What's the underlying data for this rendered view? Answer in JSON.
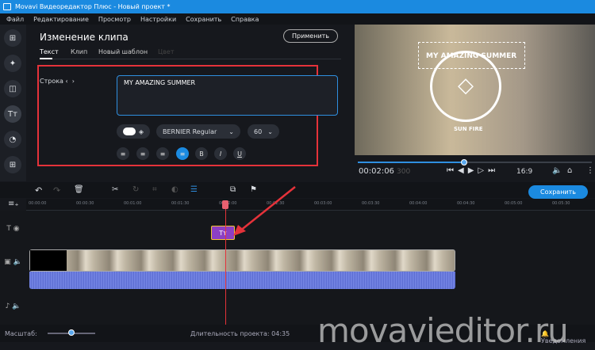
{
  "window": {
    "title": "Movavi Видеоредактор Плюс - Новый проект *"
  },
  "menu": [
    "Файл",
    "Редактирование",
    "Просмотр",
    "Настройки",
    "Сохранить",
    "Справка"
  ],
  "panel": {
    "title": "Изменение клипа",
    "apply": "Применить",
    "tabs": [
      "Текст",
      "Клип",
      "Новый шаблон",
      "Цвет"
    ],
    "row_label": "Строка",
    "text_value": "MY AMAZING SUMMER",
    "font": "BERNIER Regular",
    "size": "60",
    "format_buttons": [
      "align-left",
      "align-center",
      "align-right",
      "align-justify",
      "B",
      "I",
      "U"
    ]
  },
  "preview": {
    "overlay_title": "MY AMAZING SUMMER",
    "overlay_sub": "SUN FIRE",
    "time": "00:02:06",
    "ms": "300",
    "aspect": "16:9"
  },
  "timeline": {
    "save": "Сохранить",
    "ruler": [
      "00:00:00",
      "00:00:30",
      "00:01:00",
      "00:01:30",
      "00:02:00",
      "00:02:30",
      "00:03:00",
      "00:03:30",
      "00:04:00",
      "00:04:30",
      "00:05:00",
      "00:05:30"
    ],
    "title_clip": "Tт",
    "playhead_progress": 0.44
  },
  "status": {
    "scale_label": "Масштаб:",
    "duration": "Длительность проекта: 04:35",
    "notifications": "Уведомления",
    "watermark": "movavieditor.ru"
  }
}
